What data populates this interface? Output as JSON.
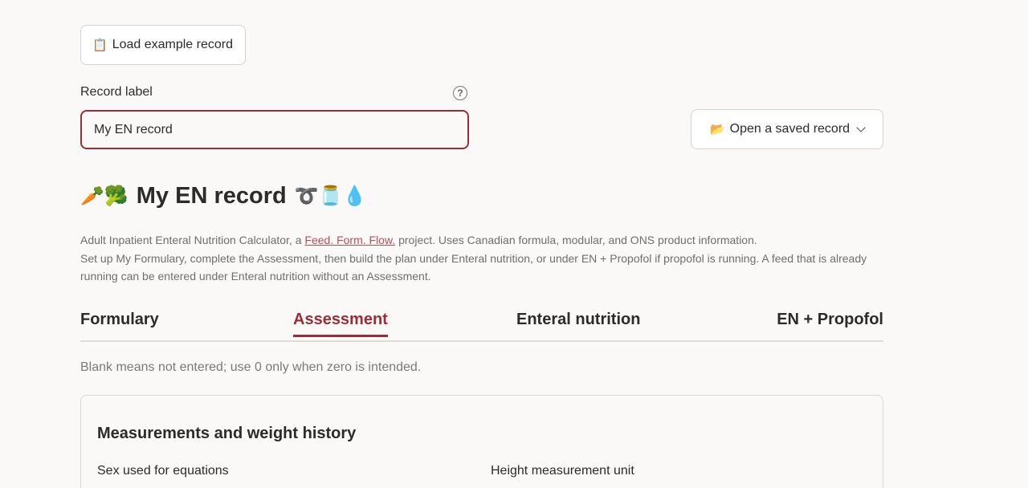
{
  "toolbar": {
    "load_example_icon": "clipboard-icon",
    "load_example_glyph": "📋",
    "load_example_label": "Load example record",
    "open_saved_icon": "folder-open-icon",
    "open_saved_glyph": "📂",
    "open_saved_label": "Open a saved record"
  },
  "record": {
    "label": "Record label",
    "value": "My EN record",
    "help_glyph": "?"
  },
  "title": {
    "emoji_pre": "🥕🥦",
    "text": "My EN record",
    "emoji_post": "➰🫙💧"
  },
  "intro": {
    "line1_pre": "Adult Inpatient Enteral Nutrition Calculator, a ",
    "link_text": "Feed. Form. Flow.",
    "line1_post": " project. Uses Canadian formula, modular, and ONS product information.",
    "line2": "Set up My Formulary, complete the Assessment, then build the plan under Enteral nutrition, or under EN + Propofol if propofol is running. A feed that is already running can be entered under Enteral nutrition without an Assessment."
  },
  "tabs": [
    {
      "label": "Formulary",
      "active": false
    },
    {
      "label": "Assessment",
      "active": true
    },
    {
      "label": "Enteral nutrition",
      "active": false
    },
    {
      "label": "EN + Propofol",
      "active": false
    }
  ],
  "hint": "Blank means not entered; use 0 only when zero is intended.",
  "section": {
    "title": "Measurements and weight history",
    "fields": {
      "sex_label": "Sex used for equations",
      "height_unit_label": "Height measurement unit"
    }
  },
  "colors": {
    "accent": "#9b2d38",
    "link": "#b0505c",
    "background": "#faf9f8"
  }
}
